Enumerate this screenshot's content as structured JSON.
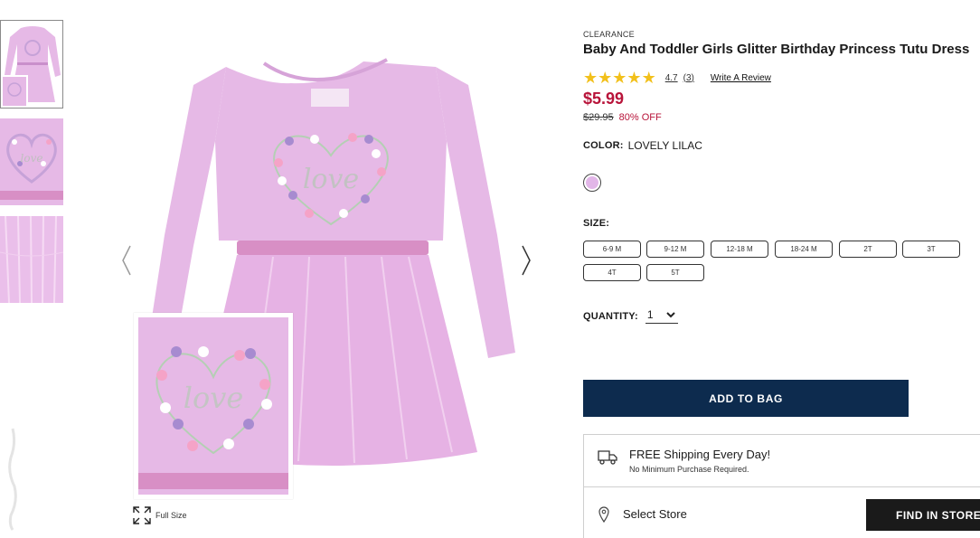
{
  "product": {
    "eyebrow": "CLEARANCE",
    "title": "Baby And Toddler Girls Glitter Birthday Princess Tutu Dress",
    "rating": {
      "stars": 5,
      "value": "4.7",
      "count": "(3)",
      "write_review": "Write A Review"
    },
    "price": "$5.99",
    "was_price": "$29.95",
    "discount": "80% OFF",
    "color": {
      "label": "COLOR:",
      "value": "LOVELY LILAC",
      "swatch_hex": "#e2b6e8"
    },
    "size": {
      "label": "SIZE:",
      "options": [
        "6-9 M",
        "9-12 M",
        "12-18 M",
        "18-24 M",
        "2T",
        "3T",
        "4T",
        "5T"
      ]
    },
    "quantity": {
      "label": "QUANTITY:",
      "value": "1"
    },
    "add_to_bag": "ADD TO BAG"
  },
  "gallery": {
    "full_size_label": "Full Size",
    "inset_text": "love",
    "shirt_text": "love",
    "thumbnails": [
      "front-view",
      "heart-detail",
      "tulle-detail"
    ],
    "selected_thumbnail": 0,
    "dress_color": "#e6b9e6"
  },
  "shipping": {
    "title": "FREE Shipping Every Day!",
    "subtitle": "No Minimum Purchase Required.",
    "store_label": "Select Store",
    "find_in_store": "FIND IN STORE"
  },
  "colors": {
    "price_red": "#b8143a",
    "navy": "#0d2b4e",
    "star_gold": "#f2c01b"
  }
}
